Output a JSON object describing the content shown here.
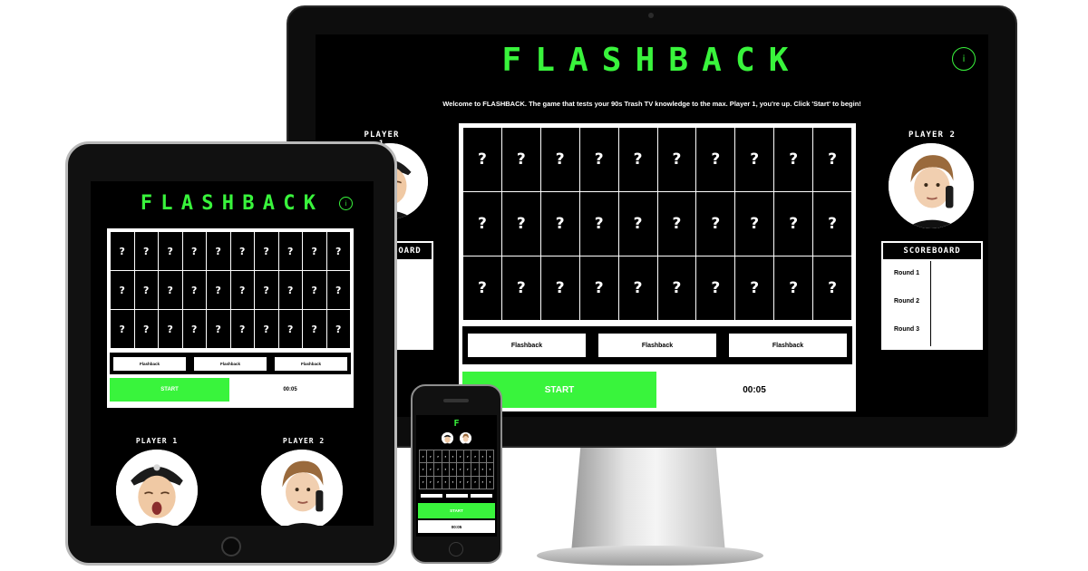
{
  "app": {
    "title": "FLASHBACK",
    "title_short": "F",
    "info_label": "i",
    "welcome": "Welcome to FLASHBACK. The game that tests your 90s Trash TV knowledge to the max.  Player 1, you're up. Click 'Start' to begin!"
  },
  "board": {
    "rows": 3,
    "cols": 10,
    "tile_label": "?"
  },
  "answers": [
    "Flashback",
    "Flashback",
    "Flashback"
  ],
  "controls": {
    "start_label": "START",
    "timer": "00:05"
  },
  "players": [
    {
      "label": "PLAYER 1"
    },
    {
      "label": "PLAYER 2"
    }
  ],
  "scoreboard": {
    "title": "SCOREBOARD",
    "rounds": [
      "Round 1",
      "Round 2",
      "Round 3"
    ]
  },
  "colors": {
    "accent": "#39f43c",
    "background": "#000000",
    "tile": "#000000",
    "text": "#ffffff"
  }
}
